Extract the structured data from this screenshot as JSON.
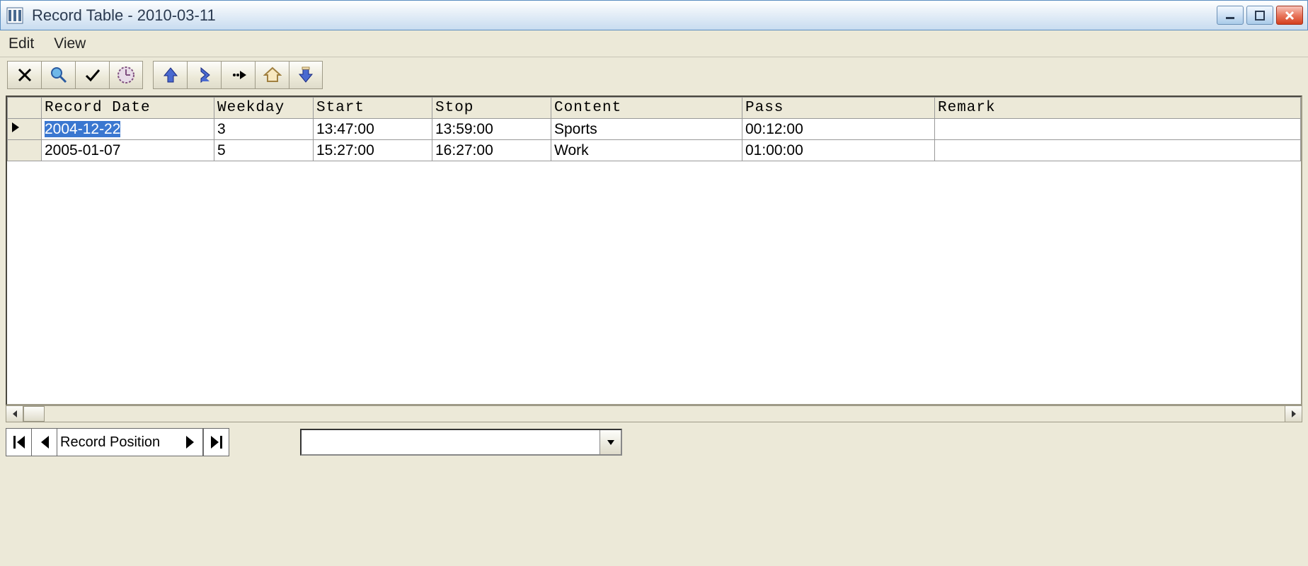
{
  "window": {
    "title": "Record Table - 2010-03-11"
  },
  "menu": {
    "edit": "Edit",
    "view": "View"
  },
  "toolbar": {
    "group1": [
      "delete",
      "search",
      "check",
      "clock"
    ],
    "group2": [
      "upload",
      "next-down",
      "forward",
      "home",
      "download"
    ]
  },
  "table": {
    "columns": [
      "Record Date",
      "Weekday",
      "Start",
      "Stop",
      "Content",
      "Pass",
      "Remark"
    ],
    "rows": [
      {
        "record_date": "2004-12-22",
        "weekday": "3",
        "start": "13:47:00",
        "stop": "13:59:00",
        "content": "Sports",
        "pass": "00:12:00",
        "remark": "",
        "selected": true,
        "current": true
      },
      {
        "record_date": "2005-01-07",
        "weekday": "5",
        "start": "15:27:00",
        "stop": "16:27:00",
        "content": "Work",
        "pass": "01:00:00",
        "remark": "",
        "selected": false,
        "current": false
      }
    ]
  },
  "footer": {
    "nav_label": "Record Position",
    "combo_value": ""
  }
}
